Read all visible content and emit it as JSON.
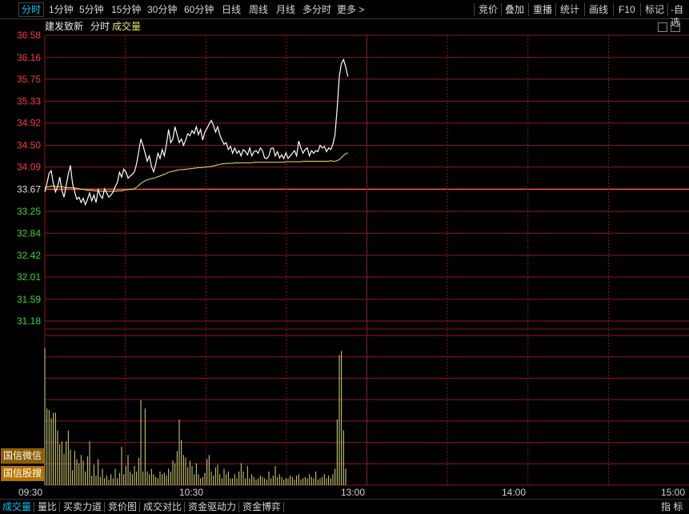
{
  "toolbar": {
    "timeframes": [
      "分时",
      "1分钟",
      "5分钟",
      "15分钟",
      "30分钟",
      "60分钟",
      "日线",
      "周线",
      "月线",
      "多分时",
      "更多 >"
    ],
    "right_buttons": [
      "竞价",
      "叠加",
      "重播",
      "统计",
      "画线",
      "F10",
      "标记",
      "-自选"
    ]
  },
  "header": {
    "stock_name": "建发致新",
    "mode": "分时",
    "indicator": "成交量"
  },
  "side_buttons": [
    "国信微信",
    "国信股搜"
  ],
  "bottom_tabs": [
    "成交量",
    "量比",
    "买卖力道",
    "竞价图",
    "成交对比",
    "资金驱动力",
    "资金博弈"
  ],
  "bottom_right": "指 标",
  "colors": {
    "grid": "#8b1a1a",
    "price_line": "#ffffff",
    "avg_line": "#e8e870",
    "volume": "#d8d880",
    "price_up": "#ff3b3b",
    "price_down": "#35d835",
    "ref_line": "#ff5050"
  },
  "chart_data": {
    "type": "line",
    "y_ticks": [
      "36.58",
      "36.16",
      "35.75",
      "35.33",
      "34.92",
      "34.50",
      "34.09",
      "33.67",
      "33.25",
      "32.84",
      "32.42",
      "32.01",
      "31.59",
      "31.18"
    ],
    "prev_close": 33.67,
    "ylim": [
      31.18,
      36.58
    ],
    "x_ticks": [
      "09:30",
      "10:30",
      "13:00",
      "14:00",
      "15:00"
    ],
    "grid": true,
    "series": [
      {
        "values": [
          33.62,
          33.78,
          33.97,
          34.02,
          33.78,
          33.62,
          33.72,
          33.9,
          33.65,
          33.52,
          33.74,
          33.95,
          34.12,
          33.78,
          33.62,
          33.48,
          33.52,
          33.42,
          33.5,
          33.38,
          33.48,
          33.6,
          33.45,
          33.56,
          33.42,
          33.66,
          33.55,
          33.5,
          33.68,
          33.6,
          33.52,
          33.56,
          33.62,
          33.72,
          33.8,
          33.99,
          33.9,
          34.05,
          34.0,
          33.88,
          33.92,
          33.95,
          34.0,
          34.15,
          34.38,
          34.62,
          34.5,
          34.35,
          34.2,
          34.3,
          34.1,
          34.0,
          34.15,
          34.35,
          34.25,
          34.42,
          34.3,
          34.52,
          34.8,
          34.55,
          34.62,
          34.85,
          34.7,
          34.55,
          34.62,
          34.5,
          34.6,
          34.72,
          34.68,
          34.78,
          34.72,
          34.85,
          34.7,
          34.8,
          34.6,
          34.75,
          34.82,
          34.9,
          34.97,
          34.88,
          34.75,
          34.85,
          34.7,
          34.6,
          34.52,
          34.55,
          34.42,
          34.48,
          34.35,
          34.45,
          34.35,
          34.4,
          34.3,
          34.42,
          34.38,
          34.32,
          34.45,
          34.3,
          34.38,
          34.4,
          34.35,
          34.45,
          34.4,
          34.26,
          34.25,
          34.3,
          34.44,
          34.45,
          34.3,
          34.38,
          34.26,
          34.32,
          34.25,
          34.36,
          34.25,
          34.3,
          34.35,
          34.4,
          34.3,
          34.58,
          34.45,
          34.35,
          34.42,
          34.45,
          34.3,
          34.4,
          34.35,
          34.4,
          34.38,
          34.5,
          34.45,
          34.48,
          34.38,
          34.45,
          34.42,
          34.52,
          34.7,
          35.2,
          35.8,
          36.05,
          36.12,
          35.98,
          35.8
        ]
      },
      {
        "values": [
          33.7,
          33.71,
          33.72,
          33.73,
          33.73,
          33.72,
          33.72,
          33.72,
          33.72,
          33.71,
          33.7,
          33.7,
          33.7,
          33.7,
          33.69,
          33.69,
          33.68,
          33.67,
          33.67,
          33.66,
          33.65,
          33.65,
          33.65,
          33.64,
          33.64,
          33.64,
          33.63,
          33.63,
          33.63,
          33.63,
          33.63,
          33.63,
          33.63,
          33.63,
          33.64,
          33.64,
          33.64,
          33.65,
          33.66,
          33.66,
          33.67,
          33.67,
          33.68,
          33.71,
          33.74,
          33.78,
          33.81,
          33.83,
          33.85,
          33.86,
          33.87,
          33.88,
          33.89,
          33.91,
          33.92,
          33.94,
          33.95,
          33.97,
          33.99,
          34.0,
          34.01,
          34.02,
          34.03,
          34.04,
          34.04,
          34.04,
          34.05,
          34.05,
          34.06,
          34.06,
          34.07,
          34.07,
          34.08,
          34.08,
          34.08,
          34.09,
          34.09,
          34.1,
          34.1,
          34.11,
          34.12,
          34.13,
          34.14,
          34.15,
          34.15,
          34.16,
          34.16,
          34.16,
          34.16,
          34.17,
          34.17,
          34.17,
          34.17,
          34.17,
          34.17,
          34.17,
          34.17,
          34.17,
          34.18,
          34.18,
          34.18,
          34.18,
          34.18,
          34.18,
          34.18,
          34.18,
          34.18,
          34.18,
          34.18,
          34.18,
          34.18,
          34.18,
          34.18,
          34.19,
          34.19,
          34.19,
          34.19,
          34.19,
          34.19,
          34.19,
          34.19,
          34.2,
          34.2,
          34.2,
          34.2,
          34.2,
          34.2,
          34.2,
          34.2,
          34.2,
          34.2,
          34.2,
          34.2,
          34.2,
          34.21,
          34.2,
          34.2,
          34.21,
          34.23,
          34.27,
          34.31,
          34.34,
          34.36
        ]
      }
    ],
    "volume": {
      "ylim": [
        0,
        100
      ],
      "values": [
        100,
        56,
        55,
        49,
        53,
        53,
        40,
        30,
        32,
        23,
        32,
        40,
        26,
        11,
        25,
        19,
        16,
        22,
        18,
        10,
        21,
        32,
        7,
        15,
        7,
        19,
        6,
        12,
        5,
        7,
        4,
        8,
        5,
        12,
        5,
        9,
        28,
        8,
        14,
        22,
        10,
        8,
        14,
        10,
        20,
        62,
        10,
        56,
        10,
        8,
        12,
        8,
        6,
        5,
        10,
        8,
        9,
        7,
        12,
        10,
        18,
        16,
        25,
        48,
        33,
        22,
        20,
        13,
        18,
        14,
        8,
        16,
        8,
        5,
        6,
        9,
        19,
        22,
        10,
        7,
        13,
        15,
        8,
        5,
        12,
        8,
        10,
        5,
        5,
        8,
        5,
        10,
        16,
        10,
        5,
        14,
        5,
        8,
        6,
        4,
        5,
        7,
        6,
        5,
        4,
        10,
        5,
        7,
        14,
        6,
        8,
        6,
        4,
        5,
        5,
        7,
        6,
        4,
        7,
        8,
        4,
        5,
        6,
        5,
        8,
        6,
        5,
        10,
        4,
        5,
        6,
        8,
        5,
        7,
        5,
        8,
        12,
        48,
        95,
        98,
        40,
        12
      ]
    }
  }
}
